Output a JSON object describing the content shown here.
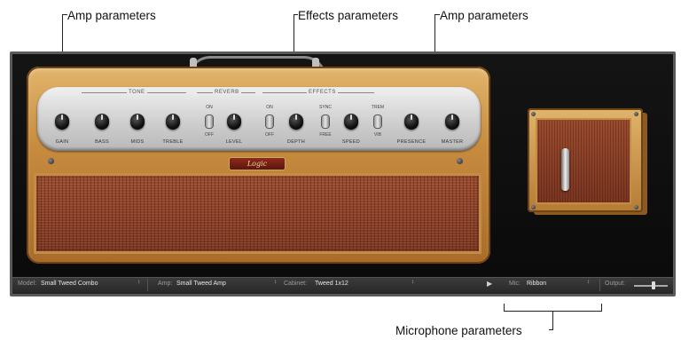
{
  "callouts": {
    "amp_left": "Amp parameters",
    "effects": "Effects parameters",
    "amp_right": "Amp parameters",
    "microphone": "Microphone parameters"
  },
  "amp": {
    "groups": {
      "tone": "TONE",
      "reverb": "REVERB",
      "effects": "EFFECTS"
    },
    "knobs": [
      {
        "label": "GAIN"
      },
      {
        "label": "BASS"
      },
      {
        "label": "MIDS"
      },
      {
        "label": "TREBLE"
      },
      {
        "label": "LEVEL"
      },
      {
        "label": "DEPTH"
      },
      {
        "label": "SPEED"
      },
      {
        "label": "PRESENCE"
      },
      {
        "label": "MASTER"
      }
    ],
    "switches": {
      "reverb": {
        "on": "ON",
        "off": "OFF"
      },
      "effects": {
        "on": "ON",
        "off": "OFF"
      },
      "sync": {
        "top": "SYNC",
        "bottom": "FREE"
      },
      "mode": {
        "top": "TREM",
        "bottom": "VIB"
      }
    },
    "logo": "Logic"
  },
  "bottom_bar": {
    "model_label": "Model:",
    "model_value": "Small Tweed Combo",
    "amp_label": "Amp:",
    "amp_value": "Small Tweed Amp",
    "cabinet_label": "Cabinet:",
    "cabinet_value": "Tweed 1x12",
    "mic_label": "Mic:",
    "mic_value": "Ribbon",
    "output_label": "Output:",
    "dropdown_arrow": "↕",
    "play_icon": "▶"
  }
}
